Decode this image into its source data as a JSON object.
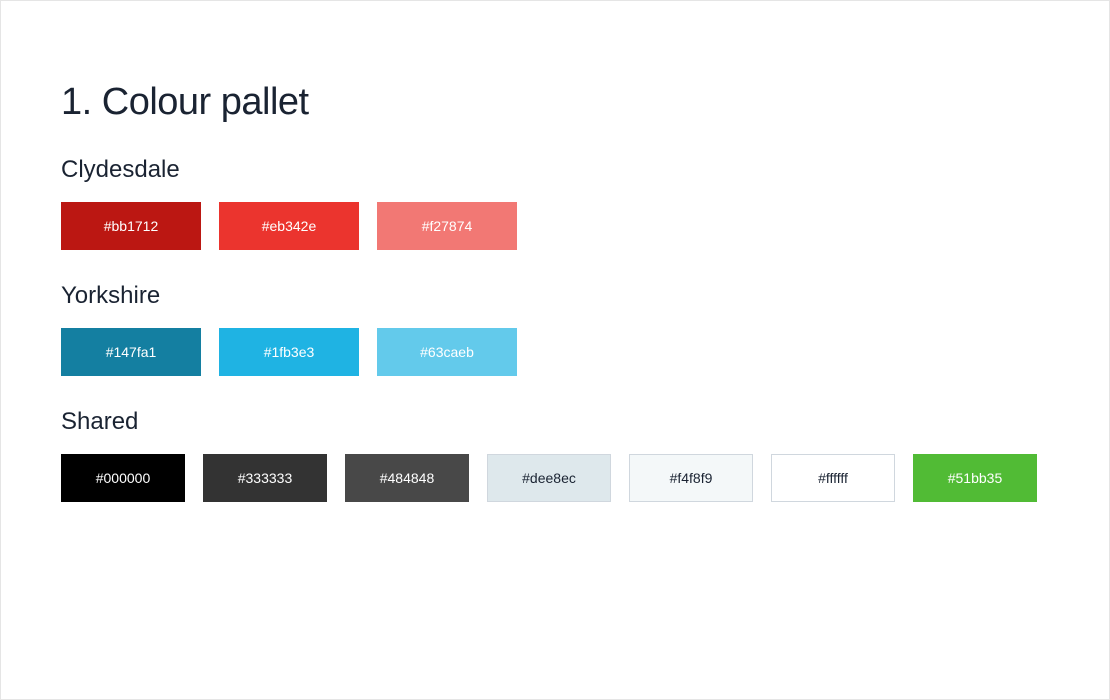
{
  "title": "1. Colour pallet",
  "groups": [
    {
      "name": "Clydesdale",
      "swatches": [
        {
          "hex": "#bb1712",
          "textClass": "light-text",
          "bordered": false
        },
        {
          "hex": "#eb342e",
          "textClass": "light-text",
          "bordered": false
        },
        {
          "hex": "#f27874",
          "textClass": "light-text",
          "bordered": false
        }
      ]
    },
    {
      "name": "Yorkshire",
      "swatches": [
        {
          "hex": "#147fa1",
          "textClass": "light-text",
          "bordered": false
        },
        {
          "hex": "#1fb3e3",
          "textClass": "light-text",
          "bordered": false
        },
        {
          "hex": "#63caeb",
          "textClass": "light-text",
          "bordered": false
        }
      ]
    },
    {
      "name": "Shared",
      "swatches": [
        {
          "hex": "#000000",
          "textClass": "light-text",
          "bordered": false
        },
        {
          "hex": "#333333",
          "textClass": "light-text",
          "bordered": false
        },
        {
          "hex": "#484848",
          "textClass": "light-text",
          "bordered": false
        },
        {
          "hex": "#dee8ec",
          "textClass": "dark-text",
          "bordered": true
        },
        {
          "hex": "#f4f8f9",
          "textClass": "dark-text",
          "bordered": true
        },
        {
          "hex": "#ffffff",
          "textClass": "dark-text",
          "bordered": true
        },
        {
          "hex": "#51bb35",
          "textClass": "light-text",
          "bordered": false
        }
      ]
    }
  ]
}
